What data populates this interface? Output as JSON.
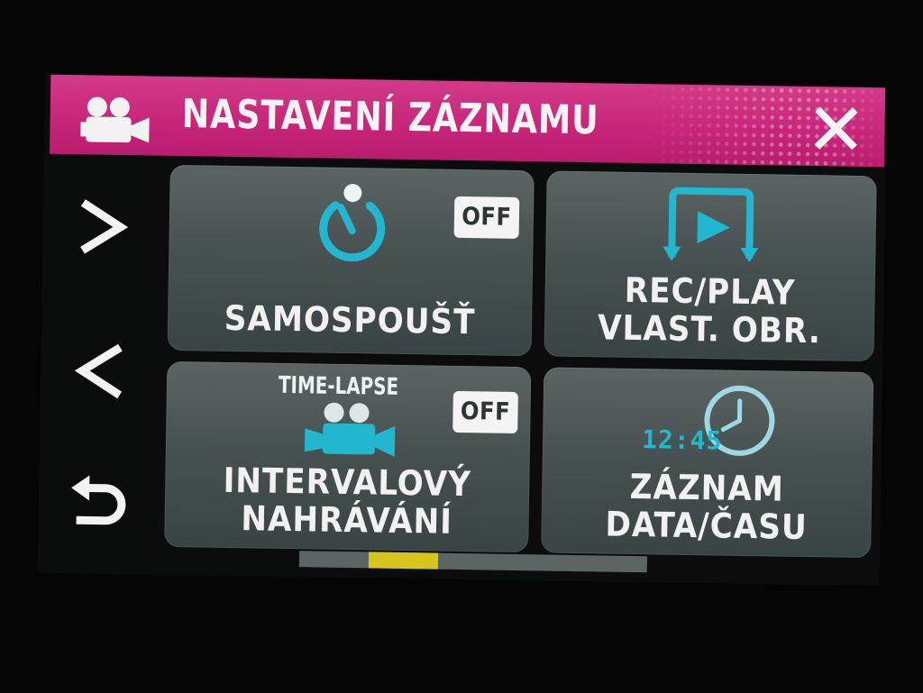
{
  "header": {
    "title": "NASTAVENÍ ZÁZNAMU",
    "accent_color": "#c8267a",
    "left_icon": "video-camera-icon",
    "close_icon": "close-icon"
  },
  "side_nav": [
    {
      "icon": "chevron-right-icon"
    },
    {
      "icon": "chevron-left-icon"
    },
    {
      "icon": "return-icon"
    }
  ],
  "tiles": [
    {
      "label_lines": [
        "SAMOSPOUŠŤ"
      ],
      "icon": "self-timer-icon",
      "badge": "OFF"
    },
    {
      "label_lines": [
        "REC/PLAY",
        "VLAST. OBR."
      ],
      "icon": "rec-play-loop-icon"
    },
    {
      "label_lines": [
        "INTERVALOVÝ",
        "NAHRÁVÁNÍ"
      ],
      "icon": "time-lapse-camera-icon",
      "caption": "TIME-LAPSE",
      "badge": "OFF"
    },
    {
      "label_lines": [
        "ZÁZNAM",
        "DATA/ČASU"
      ],
      "icon": "clock-icon",
      "clock_text": "12:45"
    }
  ],
  "pagination": {
    "page": 2,
    "pages": 5,
    "thumb_color": "#d6c51c"
  }
}
